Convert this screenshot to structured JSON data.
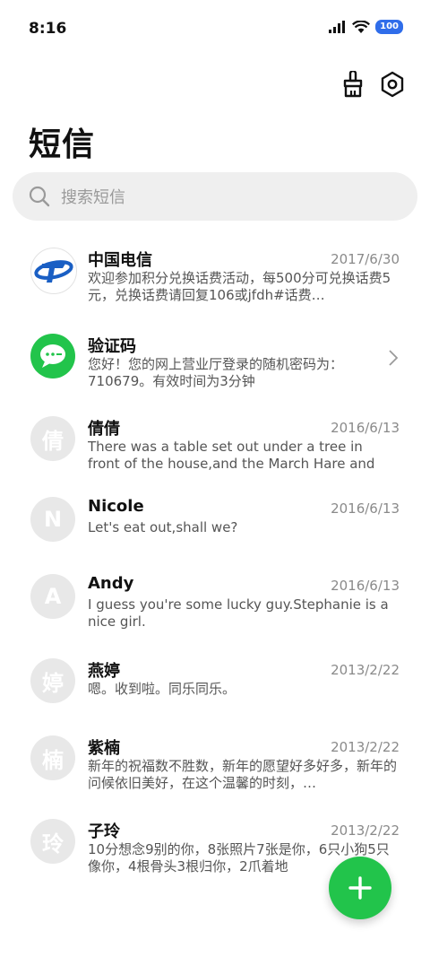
{
  "status": {
    "time": "8:16",
    "battery": "100",
    "icons": [
      "signal-icon",
      "wifi-icon",
      "battery-icon"
    ]
  },
  "toolbar": {
    "icons": [
      "broom-icon",
      "settings-icon"
    ]
  },
  "title": "短信",
  "search": {
    "placeholder": "搜索短信"
  },
  "colors": {
    "accent": "#22c44b",
    "telecom_blue": "#1a5fc4",
    "battery": "#2f6dea"
  },
  "conversations": [
    {
      "name": "中国电信",
      "date": "2017/6/30",
      "preview": "欢迎参加积分兑换话费活动，每500分可兑换话费5元，兑换话费请回复106或jfdh#话费…",
      "avatar": "china-telecom-logo"
    },
    {
      "name": "验证码",
      "date": "",
      "preview": "您好！您的网上营业厅登录的随机密码为：710679。有效时间为3分钟",
      "avatar": "message-bubble-icon"
    },
    {
      "name": "倩倩",
      "date": "2016/6/13",
      "preview": "There was a table set out under a tree in front of the house,and the March Hare and th…",
      "avatar": "倩"
    },
    {
      "name": "Nicole",
      "date": "2016/6/13",
      "preview": "Let's eat out,shall we?",
      "avatar": "N"
    },
    {
      "name": "Andy",
      "date": "2016/6/13",
      "preview": "I guess you're some lucky guy.Stephanie is a nice girl.",
      "avatar": "A"
    },
    {
      "name": "燕婷",
      "date": "2013/2/22",
      "preview": "嗯。收到啦。同乐同乐。",
      "avatar": "婷"
    },
    {
      "name": "紫楠",
      "date": "2013/2/22",
      "preview": "新年的祝福数不胜数，新年的愿望好多好多，新年的问候依旧美好，在这个温馨的时刻，…",
      "avatar": "楠"
    },
    {
      "name": "子玲",
      "date": "2013/2/22",
      "preview": "10分想念9别的你，8张照片7张是你，6只小狗5只像你，4根骨头3根归你，2爪着地",
      "avatar": "玲"
    }
  ],
  "fab": {
    "icon": "plus-icon"
  }
}
